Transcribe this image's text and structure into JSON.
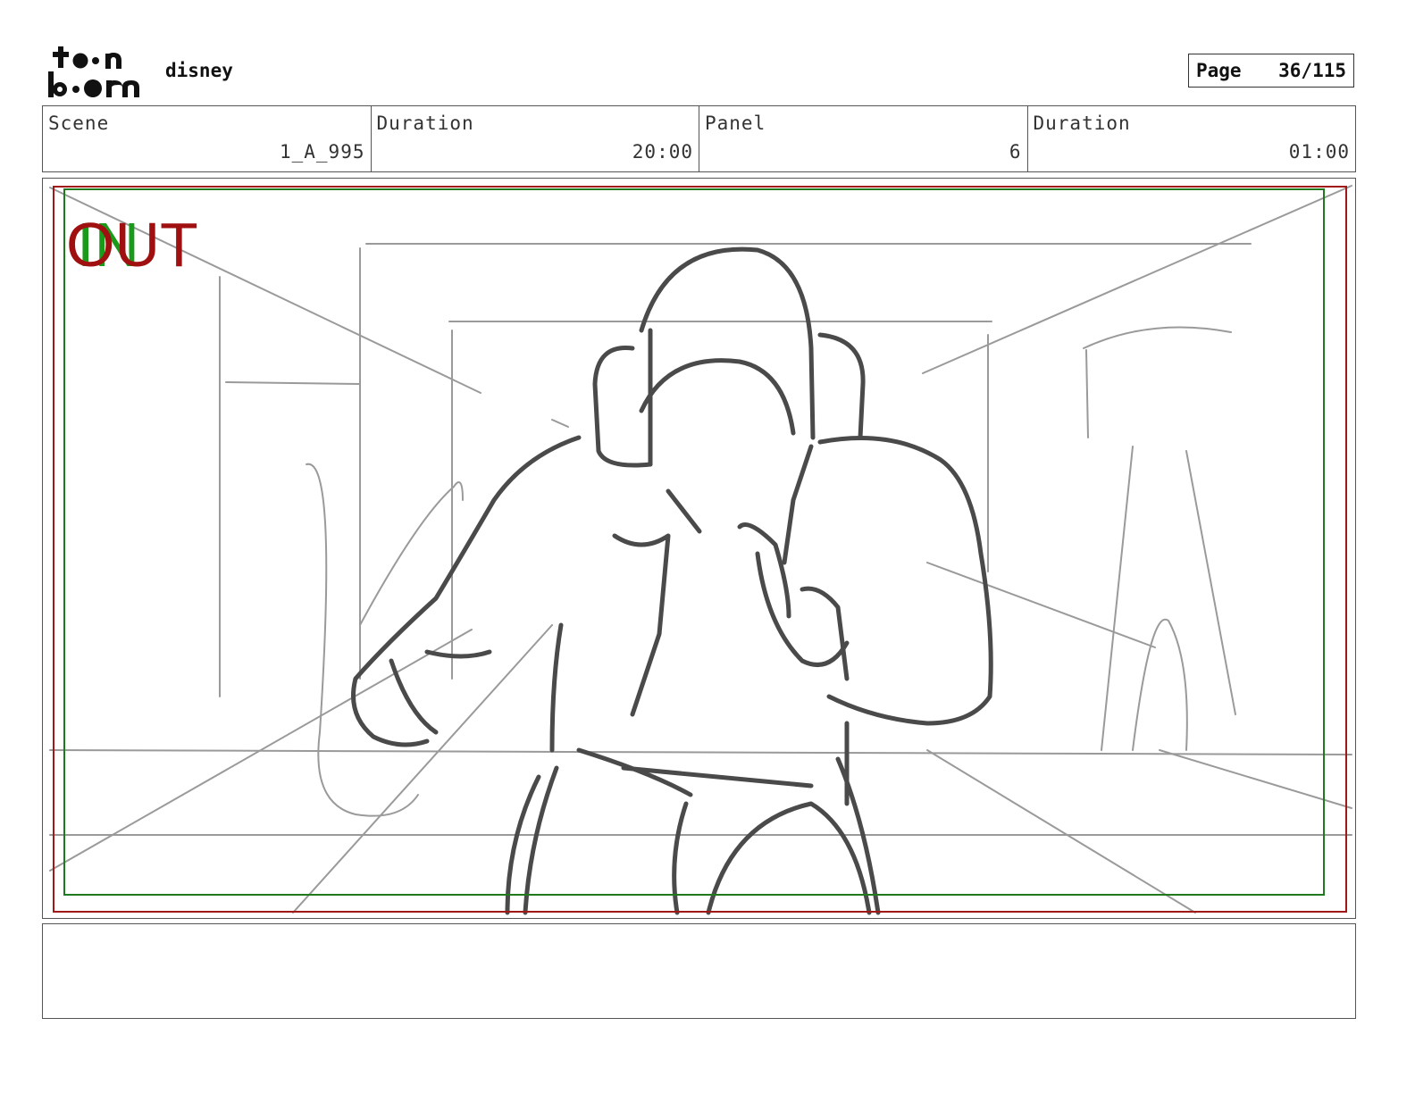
{
  "header": {
    "logo_name": "toon-boom-logo",
    "logo_text_top": "toon",
    "logo_text_bottom": "boom",
    "project_name": "disney",
    "page_label": "Page",
    "page_value": "36/115"
  },
  "info": {
    "scene_label": "Scene",
    "scene_value": "1_A_995",
    "scene_duration_label": "Duration",
    "scene_duration_value": "20:00",
    "panel_label": "Panel",
    "panel_value": "6",
    "panel_duration_label": "Duration",
    "panel_duration_value": "01:00"
  },
  "panel": {
    "in_marker": "IN",
    "out_marker": "OUT",
    "colors": {
      "in": "#1a9a1a",
      "out": "#a01010",
      "safe_frame": "#1f7a1f",
      "camera_frame": "#a01818",
      "sketch": "#555555"
    }
  },
  "notes": {
    "text": ""
  }
}
